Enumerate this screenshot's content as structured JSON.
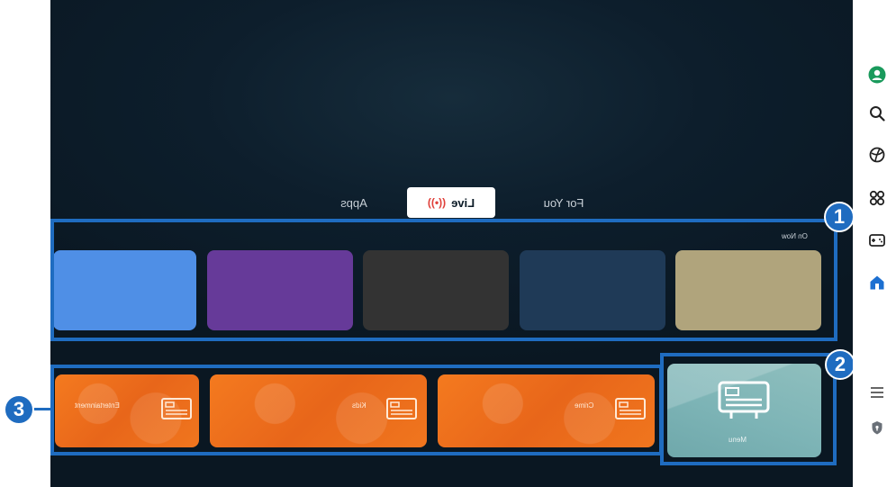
{
  "tabs": {
    "apps": "Apps",
    "live": "Live",
    "for_you": "For You"
  },
  "sections": {
    "on_now": "On Now"
  },
  "categories": [
    {
      "label": "Entertainment"
    },
    {
      "label": "Kids"
    },
    {
      "label": "Crime"
    }
  ],
  "menu_tile": {
    "label": "Menu"
  },
  "callouts": {
    "one": "1",
    "two": "2",
    "three": "3"
  },
  "on_now_tiles": [
    {
      "color": "#4f8fe6"
    },
    {
      "color": "#663a99"
    },
    {
      "color": "#333333"
    },
    {
      "color": "#1f3a57"
    },
    {
      "color": "#b0a47c"
    }
  ],
  "sidebar_icons": [
    "profile-icon",
    "search-icon",
    "ambient-icon",
    "connected-devices-icon",
    "gaming-icon",
    "home-icon",
    "menu-icon",
    "privacy-icon"
  ],
  "colors": {
    "accent": "#1f6cc0",
    "profile": "#1a9a5c",
    "home": "#1c6fd1",
    "live_mark": "#e0403a",
    "category_orange": "#f07020"
  }
}
